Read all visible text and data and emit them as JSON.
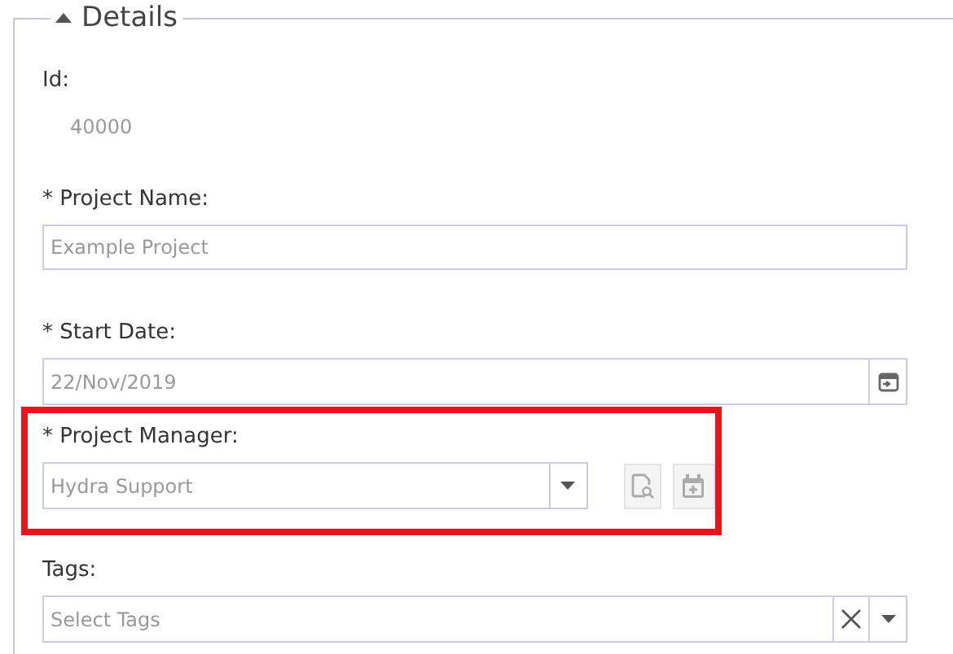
{
  "section": {
    "title": "Details",
    "expanded": true
  },
  "fields": [
    {
      "kind": "static",
      "label": "Id:",
      "value": "40000",
      "highlighted": false
    },
    {
      "kind": "text",
      "label": "* Project Name:",
      "value": "Example Project",
      "highlighted": false
    },
    {
      "kind": "date",
      "label": "* Start Date:",
      "value": "22/Nov/2019",
      "highlighted": false
    },
    {
      "kind": "select",
      "label": "* Project Manager:",
      "value": "Hydra Support",
      "highlighted": true
    },
    {
      "kind": "tags",
      "label": "Tags:",
      "placeholder": "Select Tags",
      "highlighted": false
    }
  ]
}
